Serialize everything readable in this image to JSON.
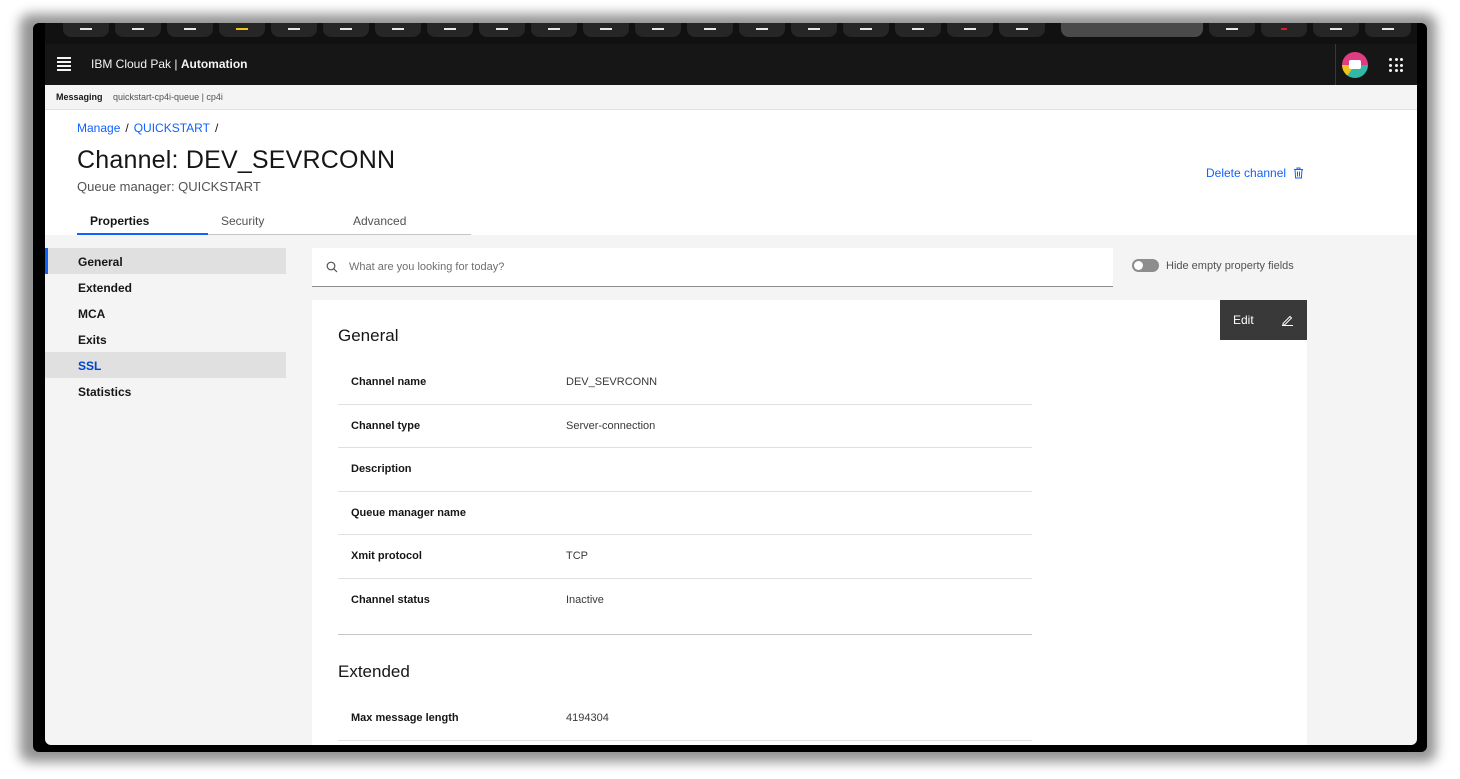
{
  "header": {
    "brand_prefix": "IBM Cloud Pak | ",
    "brand_product": "Automation"
  },
  "context_bar": {
    "section": "Messaging",
    "path": "quickstart-cp4i-queue  |  cp4i"
  },
  "breadcrumb": {
    "items": [
      "Manage",
      "QUICKSTART"
    ]
  },
  "page": {
    "title": "Channel: DEV_SEVRCONN",
    "subtitle": "Queue manager: QUICKSTART",
    "delete_label": "Delete channel"
  },
  "tabs": [
    {
      "label": "Properties",
      "selected": true
    },
    {
      "label": "Security",
      "selected": false
    },
    {
      "label": "Advanced",
      "selected": false
    }
  ],
  "sidenav": {
    "items": [
      {
        "label": "General",
        "state": "active"
      },
      {
        "label": "Extended",
        "state": "normal"
      },
      {
        "label": "MCA",
        "state": "normal"
      },
      {
        "label": "Exits",
        "state": "normal"
      },
      {
        "label": "SSL",
        "state": "highlighted"
      },
      {
        "label": "Statistics",
        "state": "normal"
      }
    ]
  },
  "search": {
    "placeholder": "What are you looking for today?"
  },
  "toggle": {
    "label": "Hide empty property fields",
    "on": false
  },
  "edit_button": {
    "label": "Edit"
  },
  "sections": [
    {
      "title": "General",
      "rows": [
        {
          "key": "Channel name",
          "value": "DEV_SEVRCONN"
        },
        {
          "key": "Channel type",
          "value": "Server-connection"
        },
        {
          "key": "Description",
          "value": ""
        },
        {
          "key": "Queue manager name",
          "value": ""
        },
        {
          "key": "Xmit protocol",
          "value": "TCP"
        },
        {
          "key": "Channel status",
          "value": "Inactive"
        }
      ]
    },
    {
      "title": "Extended",
      "rows": [
        {
          "key": "Max message length",
          "value": "4194304"
        }
      ]
    }
  ],
  "colors": {
    "accent": "#0f62fe",
    "header_bg": "#161616",
    "edit_bg": "#393939"
  }
}
